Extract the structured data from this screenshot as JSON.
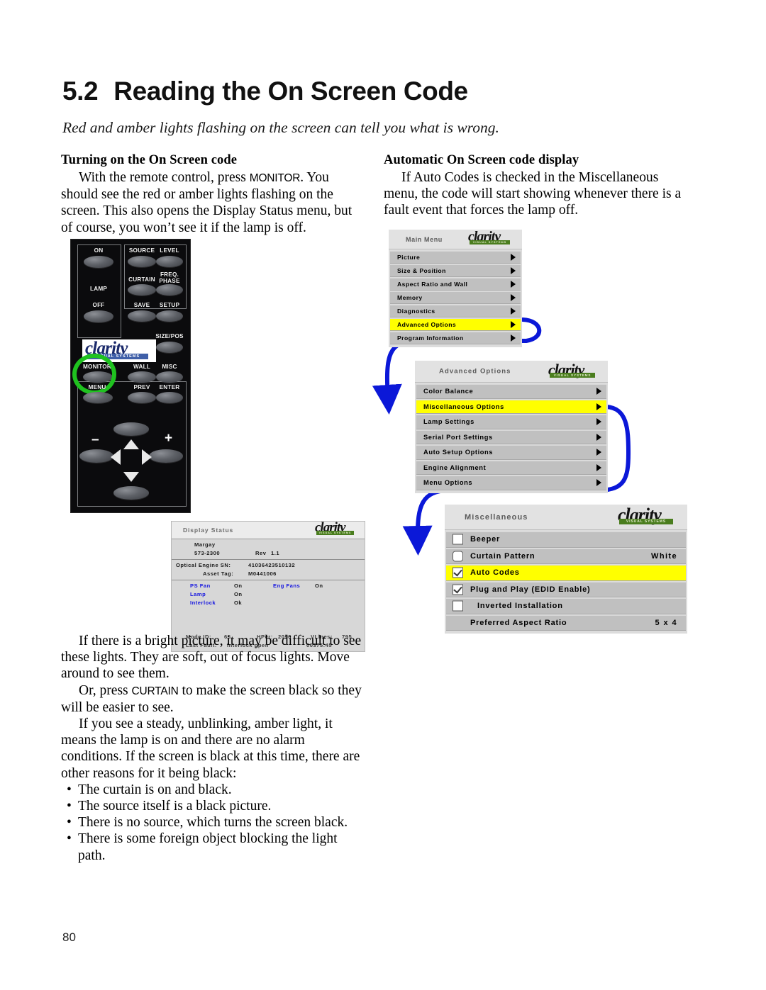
{
  "page": {
    "number": "80",
    "section_number": "5.2",
    "title": "Reading the On Screen Code",
    "subtitle": "Red and amber lights flashing on the screen can tell you what is wrong."
  },
  "left_column": {
    "heading": "Turning on the On Screen code",
    "para1_a": "With the remote control, press ",
    "para1_key": "MONITOR",
    "para1_b": ". You should see the red or amber lights flashing on the screen. This also opens the Display Status menu, but of course, you won’t see it if the lamp is off.",
    "para2": "If there is a bright picture, it may be difficult to see these lights. They are soft, out of focus lights. Move around to see them.",
    "para3_a": "Or, press ",
    "para3_key": "CURTAIN",
    "para3_b": " to make the screen black so they will be easier to see.",
    "para4": "If you see a steady, unblinking, amber light, it means the lamp is on and there are no alarm conditions. If the screen is black at this time, there are other reasons for it being black:",
    "bullets": [
      "The curtain is on and black.",
      "The source itself is a black picture.",
      "There is no source, which turns the screen black.",
      "There is some foreign object blocking the light path."
    ]
  },
  "right_column": {
    "heading": "Automatic On Screen code display",
    "para1": "If Auto Codes is checked in the Miscellaneous menu, the code will start showing whenever there is a fault event that forces the lamp off."
  },
  "remote": {
    "logo_word": "clarity",
    "logo_tagline": "VISUAL SYSTEMS",
    "buttons": [
      "ON",
      "SOURCE",
      "LEVEL",
      "LAMP",
      "CURTAIN",
      "FREQ.",
      "PHASE",
      "OFF",
      "SAVE",
      "SETUP",
      "SIZE/POS",
      "MONITOR",
      "WALL",
      "MISC",
      "MENU",
      "PREV",
      "ENTER",
      "–",
      "+"
    ],
    "labels": {
      "on": "ON",
      "source": "SOURCE",
      "level": "LEVEL",
      "lamp": "LAMP",
      "curtain": "CURTAIN",
      "freq": "FREQ.",
      "phase": "PHASE",
      "off": "OFF",
      "save": "SAVE",
      "setup": "SETUP",
      "sizepos": "SIZE/POS",
      "monitor": "MONITOR",
      "wall": "WALL",
      "misc": "MISC",
      "menu": "MENU",
      "prev": "PREV",
      "enter": "ENTER",
      "minus": "–",
      "plus": "+"
    },
    "highlight_color": "#1fc21f",
    "highlighted_button": "MONITOR"
  },
  "osd": {
    "logo_word": "clarity",
    "logo_tagline": "VISUAL SYSTEMS",
    "highlight_color": "#ffff00",
    "main_menu": {
      "title": "Main Menu",
      "items": [
        {
          "label": "Picture",
          "highlighted": false
        },
        {
          "label": "Size & Position",
          "highlighted": false
        },
        {
          "label": "Aspect Ratio and Wall",
          "highlighted": false
        },
        {
          "label": "Memory",
          "highlighted": false
        },
        {
          "label": "Diagnostics",
          "highlighted": false
        },
        {
          "label": "Advanced Options",
          "highlighted": true
        },
        {
          "label": "Program Information",
          "highlighted": false
        }
      ]
    },
    "advanced_options": {
      "title": "Advanced Options",
      "items": [
        {
          "label": "Color Balance",
          "highlighted": false
        },
        {
          "label": "Miscellaneous Options",
          "highlighted": true
        },
        {
          "label": "Lamp Settings",
          "highlighted": false
        },
        {
          "label": "Serial Port Settings",
          "highlighted": false
        },
        {
          "label": "Auto Setup Options",
          "highlighted": false
        },
        {
          "label": "Engine Alignment",
          "highlighted": false
        },
        {
          "label": "Menu Options",
          "highlighted": false
        }
      ]
    },
    "miscellaneous": {
      "title": "Miscellaneous",
      "items": [
        {
          "label": "Beeper",
          "value": "",
          "checkbox": "unchecked",
          "shape": "square",
          "highlighted": false
        },
        {
          "label": "Curtain Pattern",
          "value": "White",
          "checkbox": "unchecked",
          "shape": "rounded",
          "highlighted": false
        },
        {
          "label": "Auto Codes",
          "value": "",
          "checkbox": "checked",
          "shape": "square",
          "highlighted": true
        },
        {
          "label": "Plug and Play (EDID Enable)",
          "value": "",
          "checkbox": "checked",
          "shape": "square",
          "highlighted": false
        },
        {
          "label": "Inverted Installation",
          "value": "",
          "checkbox": "unchecked",
          "shape": "square",
          "highlighted": false
        },
        {
          "label": "Preferred Aspect Ratio",
          "value": "5 x 4",
          "checkbox": "none",
          "shape": "none",
          "highlighted": false
        }
      ]
    },
    "display_status": {
      "title": "Display Status",
      "model": "Margay",
      "part_number": "573-2300",
      "revision_label": "Rev",
      "revision": "1.1",
      "optical_engine_sn_label": "Optical Engine SN:",
      "optical_engine_sn": "41036423510132",
      "asset_tag_label": "Asset Tag:",
      "asset_tag": "M0441006",
      "status": [
        {
          "label": "PS Fan",
          "value": "On",
          "label2": "Eng Fans",
          "value2": "On"
        },
        {
          "label": "Lamp",
          "value": "On",
          "label2": "",
          "value2": ""
        },
        {
          "label": "Interlock",
          "value": "Ok",
          "label2": "",
          "value2": ""
        }
      ],
      "mode_id_label": "Mode ID:",
      "mode_id": "65",
      "hper_label": "HPer:",
      "hper": "2096",
      "vlines_label": "VLines:",
      "vlines": "795",
      "last_fault_label": "Last Fault:",
      "last_fault": "Interlock open",
      "last_fault_time": "00375:45"
    }
  },
  "connectors": {
    "color": "#0b18d8",
    "count": 3
  }
}
